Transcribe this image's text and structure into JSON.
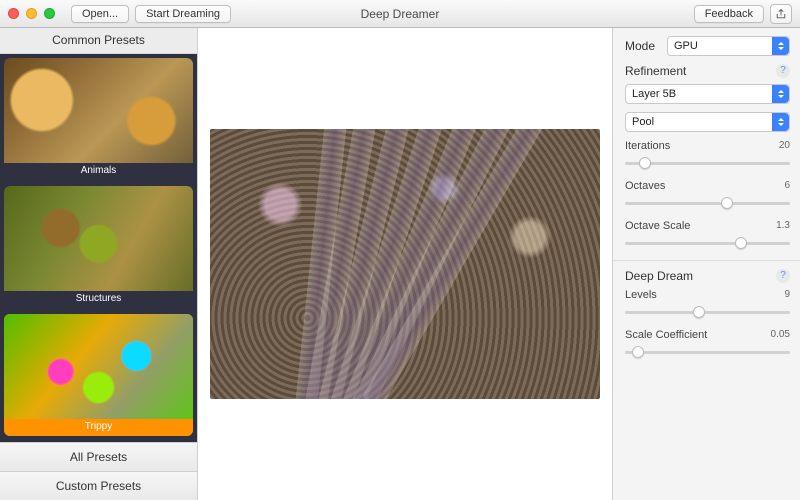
{
  "titlebar": {
    "title": "Deep Dreamer",
    "open_label": "Open...",
    "start_label": "Start Dreaming",
    "feedback_label": "Feedback"
  },
  "sidebar": {
    "header": "Common Presets",
    "presets": [
      {
        "label": "Animals",
        "selected": false
      },
      {
        "label": "Structures",
        "selected": false
      },
      {
        "label": "Trippy",
        "selected": true
      }
    ],
    "all_row": "All Presets",
    "custom_row": "Custom Presets"
  },
  "inspector": {
    "mode_label": "Mode",
    "mode_value": "GPU",
    "refinement_label": "Refinement",
    "layer_value": "Layer 5B",
    "op_value": "Pool",
    "params": [
      {
        "name": "Iterations",
        "value": "20",
        "pos": 12
      },
      {
        "name": "Octaves",
        "value": "6",
        "pos": 62
      },
      {
        "name": "Octave Scale",
        "value": "1.3",
        "pos": 70
      }
    ],
    "deep_label": "Deep Dream",
    "deep_params": [
      {
        "name": "Levels",
        "value": "9",
        "pos": 45
      },
      {
        "name": "Scale Coefficient",
        "value": "0.05",
        "pos": 8
      }
    ]
  }
}
